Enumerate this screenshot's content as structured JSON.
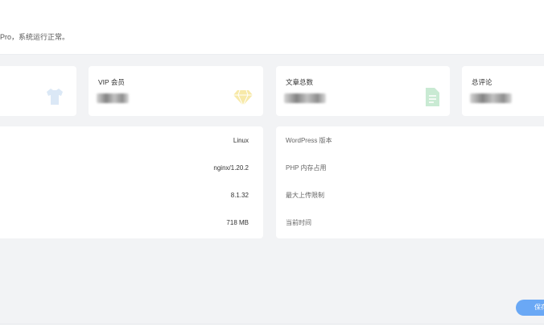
{
  "header": {
    "welcome_text": "Pro，系统运行正常。"
  },
  "stats": [
    {
      "label": "",
      "icon": "shirt-icon",
      "color": "#dbe8f6"
    },
    {
      "label": "VIP 会员",
      "icon": "diamond-icon",
      "color": "#f7e9a8"
    },
    {
      "label": "文章总数",
      "icon": "document-icon",
      "color": "#c9ead3"
    },
    {
      "label": "总评论",
      "icon": "comment-icon",
      "color": "#dbe8f6"
    }
  ],
  "server_info": {
    "values": [
      "Linux",
      "nginx/1.20.2",
      "8.1.32",
      "718 MB"
    ]
  },
  "site_info": {
    "keys": [
      "WordPress 版本",
      "PHP 内存占用",
      "最大上传限制",
      "当前时间"
    ]
  },
  "actions": {
    "save_label": "保存"
  },
  "colors": {
    "background": "#f2f3f5",
    "card": "#ffffff",
    "accent": "#6aa8f5"
  }
}
